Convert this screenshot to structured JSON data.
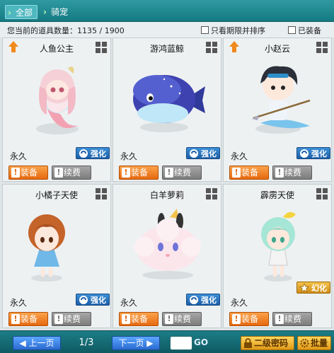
{
  "tabs": [
    {
      "label": "全部"
    },
    {
      "label": "骑宠"
    }
  ],
  "info": {
    "count_label": "您当前的道具数量：1135 / 1900",
    "filter_limited_label": "只看期限并排序",
    "filter_equipped_label": "已装备"
  },
  "items": [
    {
      "name": "人鱼公主",
      "duration": "永久",
      "badge": "强化",
      "equip": "装备",
      "renew": "续费",
      "colors": {
        "body": "#f6d7dc",
        "accent": "#e88ea0",
        "hair": "#f3c1ca"
      }
    },
    {
      "name": "游鸿蓝鲸",
      "duration": "永久",
      "badge": "强化",
      "equip": "装备",
      "renew": "续费",
      "colors": {
        "body": "#3b3fa8",
        "accent": "#a7e0f7",
        "hair": "#ffffff"
      }
    },
    {
      "name": "小赵云",
      "duration": "永久",
      "badge": "强化",
      "equip": "装备",
      "renew": "续费",
      "colors": {
        "body": "#e9f2f8",
        "accent": "#2c8fc9",
        "hair": "#2b2f3a"
      }
    },
    {
      "name": "小橘子天使",
      "duration": "永久",
      "badge": "强化",
      "equip": "装备",
      "renew": "续费",
      "colors": {
        "body": "#6fb8e8",
        "accent": "#f4d440",
        "hair": "#c4632a"
      }
    },
    {
      "name": "白羊萝莉",
      "duration": "永久",
      "badge": "强化",
      "equip": "装备",
      "renew": "续费",
      "colors": {
        "body": "#fbe6ec",
        "accent": "#f7a4b5",
        "hair": "#ffffff"
      }
    },
    {
      "name": "霹雳天使",
      "duration": "永久",
      "badge": "幻化",
      "equip": "装备",
      "renew": "续费",
      "colors": {
        "body": "#f3f3f3",
        "accent": "#f4d440",
        "hair": "#a6e6d6"
      }
    }
  ],
  "pager": {
    "prev_label": "上一页",
    "page": "1/3",
    "next_label": "下一页",
    "go_label": "GO"
  },
  "bottom": {
    "secondary_password_label": "二级密码",
    "batch_label": "批量"
  }
}
